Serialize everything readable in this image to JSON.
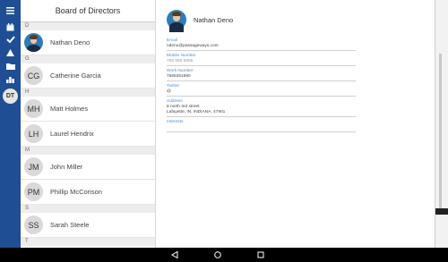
{
  "list": {
    "title": "Board of Directors",
    "sections": [
      {
        "letter": "D",
        "contacts": [
          {
            "initials": "",
            "name": "Nathan Deno",
            "photo": true
          }
        ]
      },
      {
        "letter": "G",
        "contacts": [
          {
            "initials": "CG",
            "name": "Catherine Garcia"
          }
        ]
      },
      {
        "letter": "H",
        "contacts": [
          {
            "initials": "MH",
            "name": "Matt Holmes"
          },
          {
            "initials": "LH",
            "name": "Laurel Hendrix"
          }
        ]
      },
      {
        "letter": "M",
        "contacts": [
          {
            "initials": "JM",
            "name": "John Miller"
          },
          {
            "initials": "PM",
            "name": "Phillip McCorison"
          }
        ]
      },
      {
        "letter": "S",
        "contacts": [
          {
            "initials": "SS",
            "name": "Sarah Steele"
          }
        ]
      },
      {
        "letter": "T",
        "contacts": [
          {
            "initials": "",
            "name": ""
          }
        ]
      }
    ]
  },
  "rail": {
    "user_initials": "DT",
    "icons": [
      "menu-icon",
      "calendar-icon",
      "check-icon",
      "warning-icon",
      "folder-icon",
      "chart-icon"
    ]
  },
  "detail": {
    "name": "Nathan Deno",
    "fields": [
      {
        "label": "Email",
        "value": "ndeno@passageways.com"
      },
      {
        "label": "Mobile Number",
        "value": "765 555 5555",
        "muted": true
      },
      {
        "label": "Work Number",
        "value": "7565351880"
      },
      {
        "label": "Twitter",
        "value": "@"
      },
      {
        "label": "Address",
        "value": "8 north 3rd street",
        "value2": "Lafayette, IN, INDIANA, 47901"
      },
      {
        "label": "Interests",
        "value": ""
      }
    ]
  },
  "colors": {
    "rail": "#1f4e95",
    "label": "#4a90d9"
  },
  "navbar": {
    "icons": [
      "back-icon",
      "home-icon",
      "recents-icon"
    ]
  }
}
